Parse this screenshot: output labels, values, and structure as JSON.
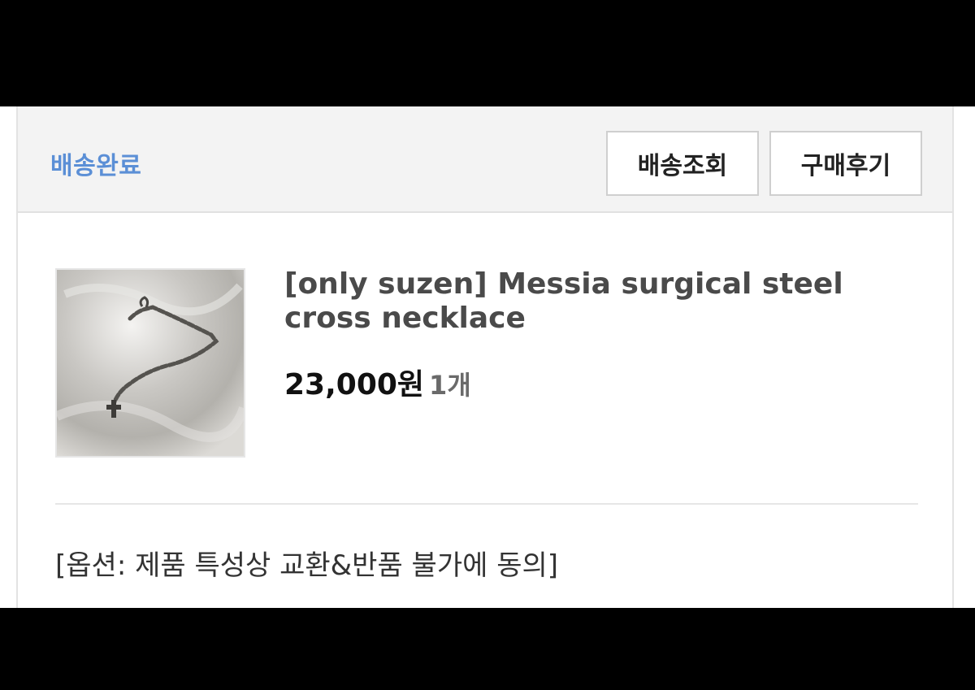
{
  "order": {
    "status": "배송완료",
    "buttons": {
      "track": "배송조회",
      "review": "구매후기"
    }
  },
  "product": {
    "name": "[only suzen] Messia surgical steel cross necklace",
    "price": "23,000원",
    "quantity": "1개",
    "image_icon": "necklace-photo"
  },
  "option": {
    "text": "[옵션: 제품 특성상 교환&반품 불가에 동의]"
  },
  "colors": {
    "status_blue": "#5b8fd6",
    "header_bg": "#f3f3f3",
    "border": "#cfcfcf"
  }
}
